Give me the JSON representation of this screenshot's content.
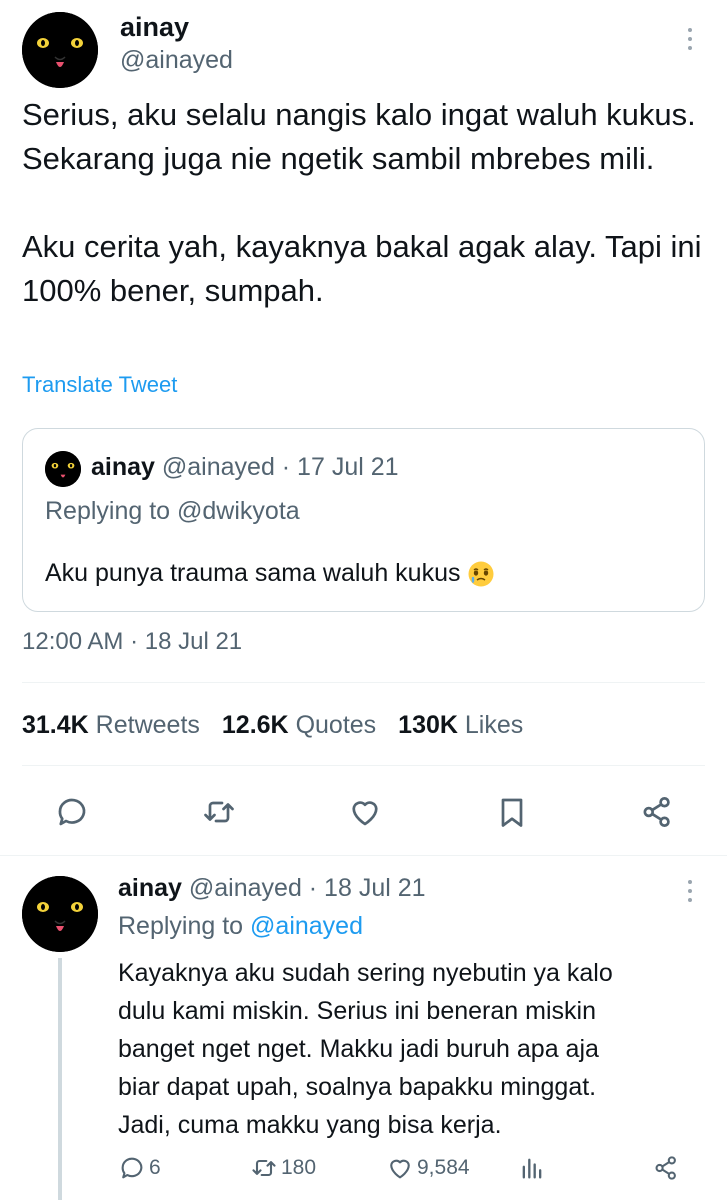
{
  "tweet": {
    "author_name": "ainay",
    "author_handle": "@ainayed",
    "text": "Serius, aku selalu nangis kalo ingat waluh kukus. Sekarang juga nie ngetik sambil mbrebes mili.\n\nAku cerita yah, kayaknya bakal agak alay. Tapi ini 100% bener, sumpah.",
    "translate_label": "Translate Tweet",
    "timestamp": "12:00 AM · 18 Jul 21"
  },
  "quote": {
    "author_name": "ainay",
    "handle_date": "@ainayed · 17 Jul 21",
    "replying_to": "Replying to @dwikyota",
    "text": "Aku punya trauma sama waluh kukus",
    "emoji_icon": "face-holding-back-tears-icon"
  },
  "stats": {
    "retweets_count": "31.4K",
    "retweets_label": "Retweets",
    "quotes_count": "12.6K",
    "quotes_label": "Quotes",
    "likes_count": "130K",
    "likes_label": "Likes"
  },
  "actions": [
    "reply-icon",
    "retweet-icon",
    "like-icon",
    "bookmark-icon",
    "share-icon"
  ],
  "reply": {
    "author_name": "ainay",
    "handle_date": "@ainayed · 18 Jul 21",
    "replying_prefix": "Replying to",
    "replying_handle": "@ainayed",
    "text": "Kayaknya aku sudah sering nyebutin ya kalo\ndulu kami miskin. Serius ini beneran miskin\nbanget nget nget. Makku jadi buruh apa aja\nbiar dapat upah, soalnya bapakku minggat.\nJadi, cuma makku yang bisa kerja.",
    "reply_count": "6",
    "retweet_count": "180",
    "like_count": "9,584"
  },
  "colors": {
    "accent": "#1d9bf0",
    "text": "#0f1419",
    "muted": "#536471",
    "border": "#cfd9de"
  }
}
